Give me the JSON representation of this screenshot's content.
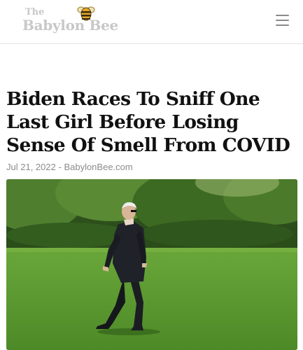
{
  "header": {
    "logo": {
      "the_text": "The",
      "name_text": "Babylon Bee",
      "icon": "bee-icon"
    },
    "menu_icon": "hamburger-menu-icon"
  },
  "article": {
    "headline": "Biden Races To Sniff One Last Girl Before Losing Sense Of Smell From COVID",
    "date": "Jul 21, 2022",
    "separator": "-",
    "source": "BabylonBee.com",
    "image": "man-walking-on-lawn-photo"
  },
  "colors": {
    "logo_grey": "#c8c8c8",
    "bee_gold": "#e0a92a",
    "headline": "#111111",
    "meta": "#8c8c8c",
    "lawn": "#5e9a32"
  }
}
